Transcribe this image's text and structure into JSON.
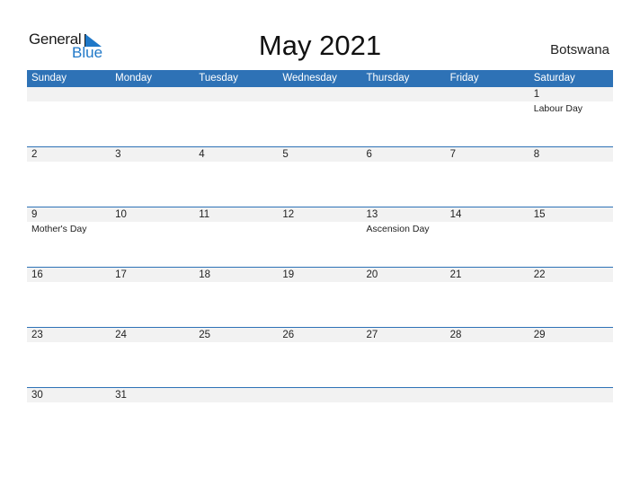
{
  "logo": {
    "word1": "General",
    "word2": "Blue"
  },
  "title": "May 2021",
  "country": "Botswana",
  "colors": {
    "header": "#2e72b6",
    "strip": "#f2f2f2",
    "logo_blue": "#1f78c8"
  },
  "weekdays": [
    "Sunday",
    "Monday",
    "Tuesday",
    "Wednesday",
    "Thursday",
    "Friday",
    "Saturday"
  ],
  "weeks": [
    [
      {
        "d": ""
      },
      {
        "d": ""
      },
      {
        "d": ""
      },
      {
        "d": ""
      },
      {
        "d": ""
      },
      {
        "d": ""
      },
      {
        "d": "1",
        "h": "Labour Day"
      }
    ],
    [
      {
        "d": "2"
      },
      {
        "d": "3"
      },
      {
        "d": "4"
      },
      {
        "d": "5"
      },
      {
        "d": "6"
      },
      {
        "d": "7"
      },
      {
        "d": "8"
      }
    ],
    [
      {
        "d": "9",
        "h": "Mother's Day"
      },
      {
        "d": "10"
      },
      {
        "d": "11"
      },
      {
        "d": "12"
      },
      {
        "d": "13",
        "h": "Ascension Day"
      },
      {
        "d": "14"
      },
      {
        "d": "15"
      }
    ],
    [
      {
        "d": "16"
      },
      {
        "d": "17"
      },
      {
        "d": "18"
      },
      {
        "d": "19"
      },
      {
        "d": "20"
      },
      {
        "d": "21"
      },
      {
        "d": "22"
      }
    ],
    [
      {
        "d": "23"
      },
      {
        "d": "24"
      },
      {
        "d": "25"
      },
      {
        "d": "26"
      },
      {
        "d": "27"
      },
      {
        "d": "28"
      },
      {
        "d": "29"
      }
    ],
    [
      {
        "d": "30"
      },
      {
        "d": "31"
      },
      {
        "d": ""
      },
      {
        "d": ""
      },
      {
        "d": ""
      },
      {
        "d": ""
      },
      {
        "d": ""
      }
    ]
  ]
}
